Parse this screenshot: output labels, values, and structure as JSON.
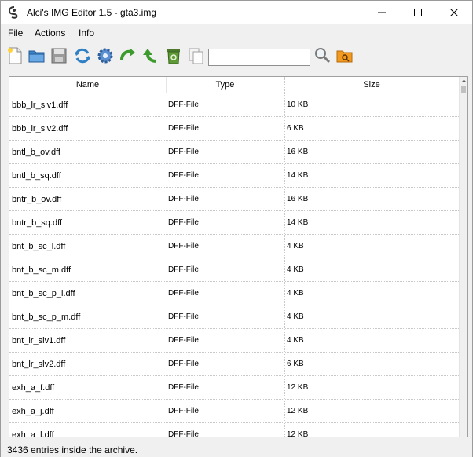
{
  "window": {
    "title": "Alci's IMG Editor 1.5 - gta3.img"
  },
  "menu": {
    "file": "File",
    "actions": "Actions",
    "info": "Info"
  },
  "toolbar": {
    "buttons": [
      "new-file-icon",
      "open-folder-icon",
      "save-icon",
      "refresh-icon",
      "settings-icon",
      "rotate-icon",
      "import-icon",
      "delete-icon",
      "copy-icon",
      "search-icon",
      "open-archive-icon"
    ],
    "search": {
      "value": "",
      "placeholder": ""
    }
  },
  "table": {
    "columns": {
      "name": "Name",
      "type": "Type",
      "size": "Size"
    },
    "rows": [
      {
        "name": "bbb_lr_slv1.dff",
        "type": "DFF-File",
        "size": "10 KB"
      },
      {
        "name": "bbb_lr_slv2.dff",
        "type": "DFF-File",
        "size": "6 KB"
      },
      {
        "name": "bntl_b_ov.dff",
        "type": "DFF-File",
        "size": "16 KB"
      },
      {
        "name": "bntl_b_sq.dff",
        "type": "DFF-File",
        "size": "14 KB"
      },
      {
        "name": "bntr_b_ov.dff",
        "type": "DFF-File",
        "size": "16 KB"
      },
      {
        "name": "bntr_b_sq.dff",
        "type": "DFF-File",
        "size": "14 KB"
      },
      {
        "name": "bnt_b_sc_l.dff",
        "type": "DFF-File",
        "size": "4 KB"
      },
      {
        "name": "bnt_b_sc_m.dff",
        "type": "DFF-File",
        "size": "4 KB"
      },
      {
        "name": "bnt_b_sc_p_l.dff",
        "type": "DFF-File",
        "size": "4 KB"
      },
      {
        "name": "bnt_b_sc_p_m.dff",
        "type": "DFF-File",
        "size": "4 KB"
      },
      {
        "name": "bnt_lr_slv1.dff",
        "type": "DFF-File",
        "size": "4 KB"
      },
      {
        "name": "bnt_lr_slv2.dff",
        "type": "DFF-File",
        "size": "6 KB"
      },
      {
        "name": "exh_a_f.dff",
        "type": "DFF-File",
        "size": "12 KB"
      },
      {
        "name": "exh_a_j.dff",
        "type": "DFF-File",
        "size": "12 KB"
      },
      {
        "name": "exh_a_l.dff",
        "type": "DFF-File",
        "size": "12 KB"
      }
    ]
  },
  "status": {
    "text": "3436 entries inside the archive."
  }
}
